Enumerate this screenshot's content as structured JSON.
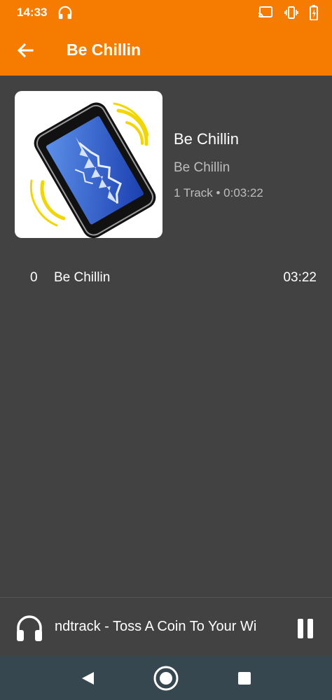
{
  "status_bar": {
    "time": "14:33",
    "icons": [
      "headphones-icon",
      "cast-icon",
      "vibrate-icon",
      "battery-icon"
    ]
  },
  "app_bar": {
    "title": "Be Chillin",
    "back_icon": "arrow-back-icon",
    "color": "#F57C00"
  },
  "album": {
    "title": "Be Chillin",
    "artist": "Be Chillin",
    "meta": "1 Track • 0:03:22",
    "cover_icon": "vibrating-phone-waveform"
  },
  "tracks": [
    {
      "number": "0",
      "name": "Be Chillin",
      "duration": "03:22"
    }
  ],
  "mini_player": {
    "title": "Soundtrack - Toss A Coin To Your Witcher",
    "visible_title": "ndtrack - Toss A Coin To Your Wi",
    "icon": "headphones-icon",
    "control": "pause-icon"
  },
  "nav_bar": {
    "buttons": [
      "back-triangle-icon",
      "home-circle-icon",
      "recents-square-icon"
    ]
  },
  "colors": {
    "accent": "#F57C00",
    "background": "#424242",
    "secondary_text": "#BDBDBD",
    "nav_bar": "#37474F"
  }
}
